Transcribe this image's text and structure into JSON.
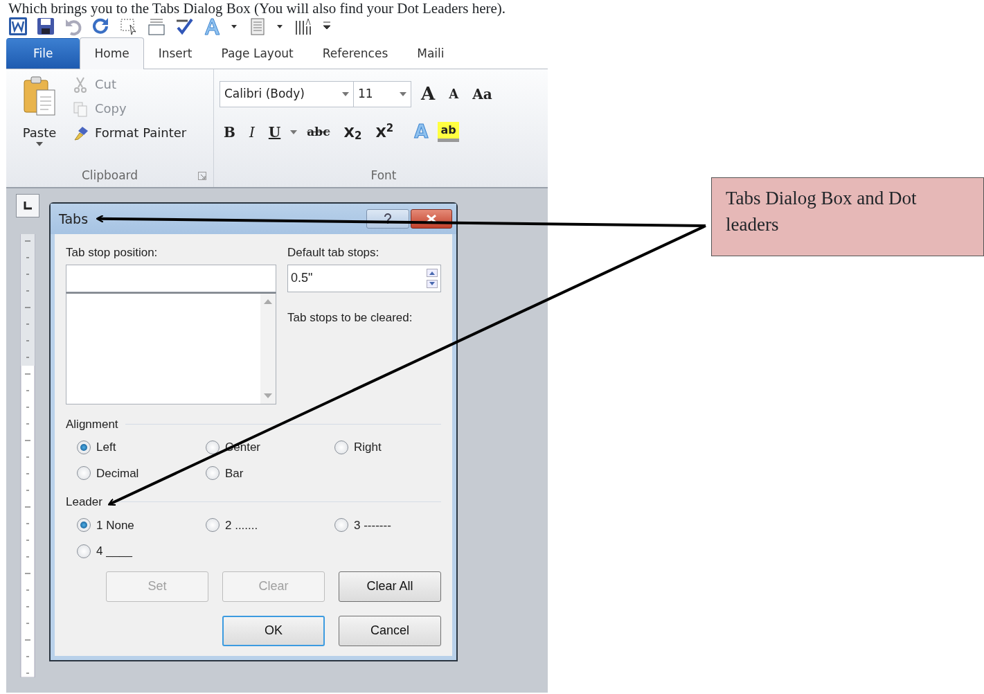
{
  "caption": "Which brings you to the Tabs Dialog Box (You will also find your Dot Leaders here).",
  "ribbon_tabs": [
    {
      "label": "File",
      "kind": "file",
      "selected": false
    },
    {
      "label": "Home",
      "kind": "tab",
      "selected": true
    },
    {
      "label": "Insert",
      "kind": "tab",
      "selected": false
    },
    {
      "label": "Page Layout",
      "kind": "tab",
      "selected": false
    },
    {
      "label": "References",
      "kind": "tab",
      "selected": false
    },
    {
      "label": "Maili",
      "kind": "tab",
      "selected": false
    }
  ],
  "clipboard": {
    "paste": "Paste",
    "group": "Clipboard",
    "items": [
      {
        "label": "Cut",
        "kind": "cut",
        "disabled": true
      },
      {
        "label": "Copy",
        "kind": "copy",
        "disabled": true
      },
      {
        "label": "Format Painter",
        "kind": "painter",
        "disabled": false
      }
    ]
  },
  "font": {
    "group": "Font",
    "font_name": "Calibri (Body)",
    "font_size": "11",
    "grow": "A",
    "shrink": "A",
    "change_case": "Aa",
    "format_buttons": [
      {
        "label": "B",
        "kind": "bold"
      },
      {
        "label": "I",
        "kind": "italic"
      },
      {
        "label": "U",
        "kind": "underline"
      },
      {
        "label": "abc",
        "kind": "strike"
      },
      {
        "label": "X$_{2}$",
        "kind": "sub"
      },
      {
        "label": "X$^{2}$",
        "kind": "sup"
      }
    ],
    "effects": "A",
    "highlight": "ab"
  },
  "dialog": {
    "title": "Tabs",
    "tab_stop_label": "Tab stop position:",
    "default_label": "Default tab stops:",
    "default_value": "0.5\"",
    "cleared_label": "Tab stops to be cleared:",
    "alignment_label": "Alignment",
    "alignment": [
      {
        "label": "Left",
        "checked": true
      },
      {
        "label": "Center",
        "checked": false
      },
      {
        "label": "Right",
        "checked": false
      },
      {
        "label": "Decimal",
        "checked": false
      },
      {
        "label": "Bar",
        "checked": false
      }
    ],
    "leader_label": "Leader",
    "leader": [
      {
        "label": "1 None",
        "checked": true
      },
      {
        "label": "2 .......",
        "checked": false
      },
      {
        "label": "3 -------",
        "checked": false
      },
      {
        "label": "4 ____",
        "checked": false
      }
    ],
    "buttons": [
      {
        "label": "Set",
        "disabled": true,
        "default": false
      },
      {
        "label": "Clear",
        "disabled": true,
        "default": false
      },
      {
        "label": "Clear All",
        "disabled": false,
        "default": false
      },
      {
        "label": "OK",
        "disabled": false,
        "default": true
      },
      {
        "label": "Cancel",
        "disabled": false,
        "default": false
      }
    ]
  },
  "callout": {
    "text": "Tabs Dialog Box and Dot leaders"
  }
}
